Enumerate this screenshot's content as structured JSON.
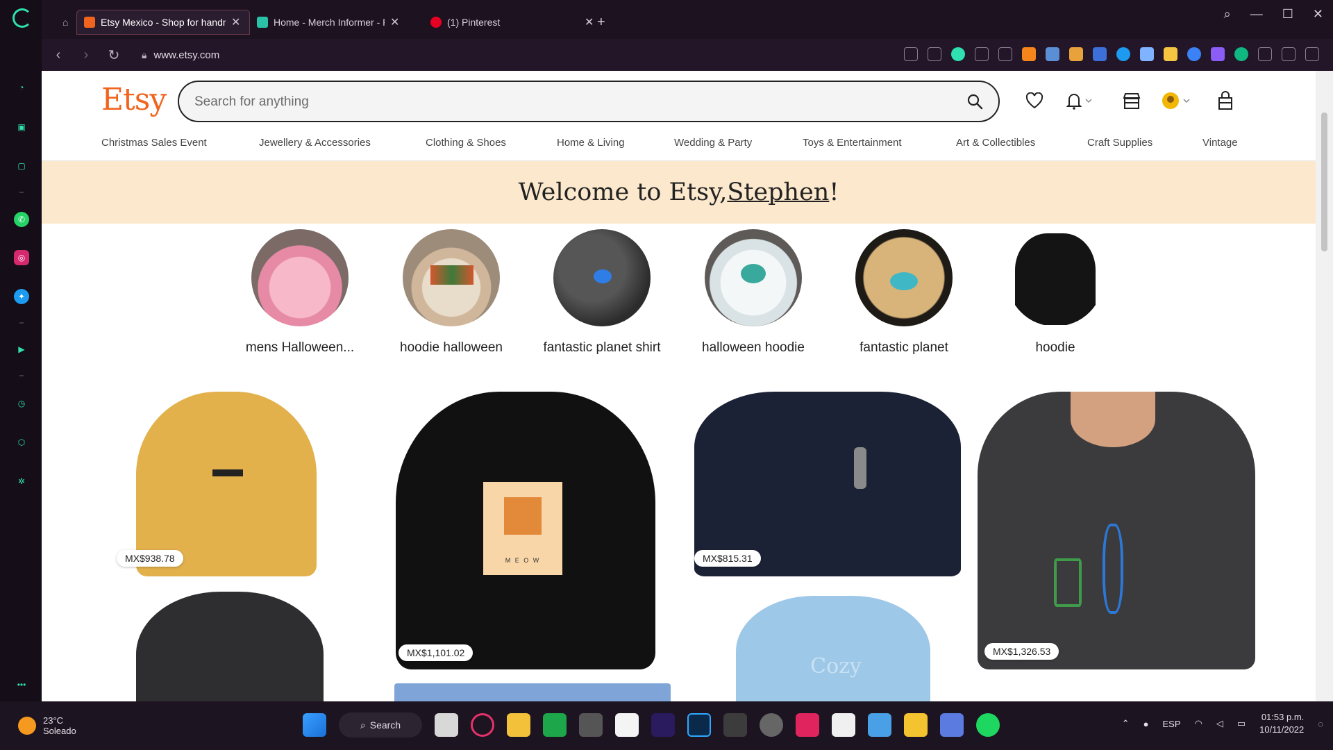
{
  "browser": {
    "tabs": [
      {
        "label": "Etsy Mexico - Shop for handmade",
        "favicon_color": "#f1641e",
        "active": true
      },
      {
        "label": "Home - Merch Informer - Find",
        "favicon_color": "#29c1a8",
        "active": false
      },
      {
        "label": "(1) Pinterest",
        "favicon_color": "#e60023",
        "active": false
      }
    ],
    "new_tab_label": "+",
    "url": "www.etsy.com"
  },
  "header": {
    "logo": "Etsy",
    "search_placeholder": "Search for anything"
  },
  "categories": [
    "Christmas Sales Event",
    "Jewellery & Accessories",
    "Clothing & Shoes",
    "Home & Living",
    "Wedding & Party",
    "Toys & Entertainment",
    "Art & Collectibles",
    "Craft Supplies",
    "Vintage"
  ],
  "welcome": {
    "prefix": "Welcome to Etsy, ",
    "name": "Stephen",
    "suffix": "!"
  },
  "recent_searches": [
    {
      "label": "mens Halloween...",
      "image_color": "#f2a0b8"
    },
    {
      "label": "hoodie halloween",
      "image_color": "#cbb9a6"
    },
    {
      "label": "fantastic planet shirt",
      "image_color": "#3c3c3c"
    },
    {
      "label": "halloween hoodie",
      "image_color": "#e8eef0"
    },
    {
      "label": "fantastic planet",
      "image_color": "#c89a58"
    },
    {
      "label": "hoodie",
      "image_color": "#111111"
    }
  ],
  "products": [
    {
      "price": "MX$938.78",
      "color": "#e2b14c"
    },
    {
      "price": "MX$1,101.02",
      "color": "#111111"
    },
    {
      "price": "MX$815.31",
      "color": "#1b2235"
    },
    {
      "price": "MX$1,326.53",
      "color": "#3b3b3d"
    },
    {
      "price": "",
      "color": "#2e2e30"
    },
    {
      "price": "",
      "color": "#7fa4d8"
    },
    {
      "price": "",
      "color": "#9ec8e8"
    }
  ],
  "product_text": {
    "pixel_cat_caption": "M E O W",
    "blue_hoodie_text": "Cozy"
  },
  "taskbar": {
    "weather_temp": "23°C",
    "weather_desc": "Soleado",
    "search_label": "Search",
    "language": "ESP",
    "time": "01:53 p.m.",
    "date": "10/11/2022"
  }
}
